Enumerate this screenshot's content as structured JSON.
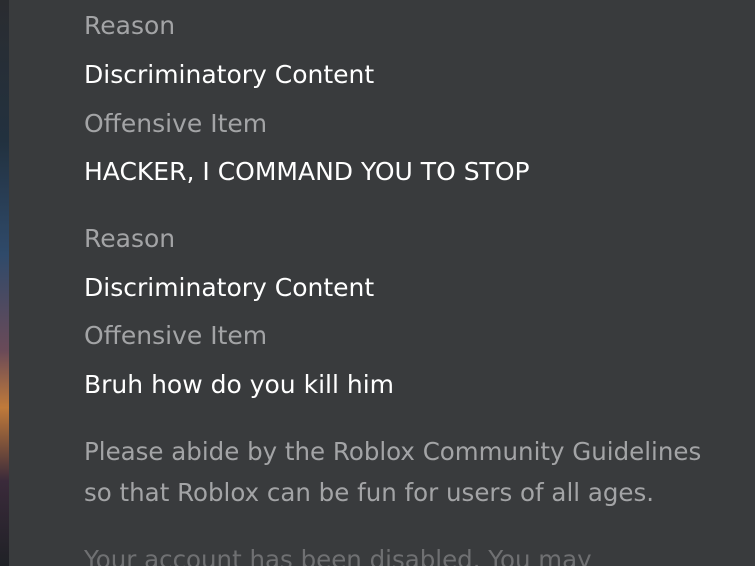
{
  "violations": [
    {
      "reason_label": "Reason",
      "reason_value": "Discriminatory Content",
      "item_label": "Offensive Item",
      "item_value": "HACKER, I COMMAND YOU TO STOP"
    },
    {
      "reason_label": "Reason",
      "reason_value": "Discriminatory Content",
      "item_label": "Offensive Item",
      "item_value": "Bruh how do you kill him"
    }
  ],
  "guidelines_note": {
    "line1": "Please abide by the Roblox Community Guidelines",
    "line2": "so that Roblox can be fun for users of all ages."
  },
  "disabled_notice_partial": "Your account has been disabled. You may"
}
